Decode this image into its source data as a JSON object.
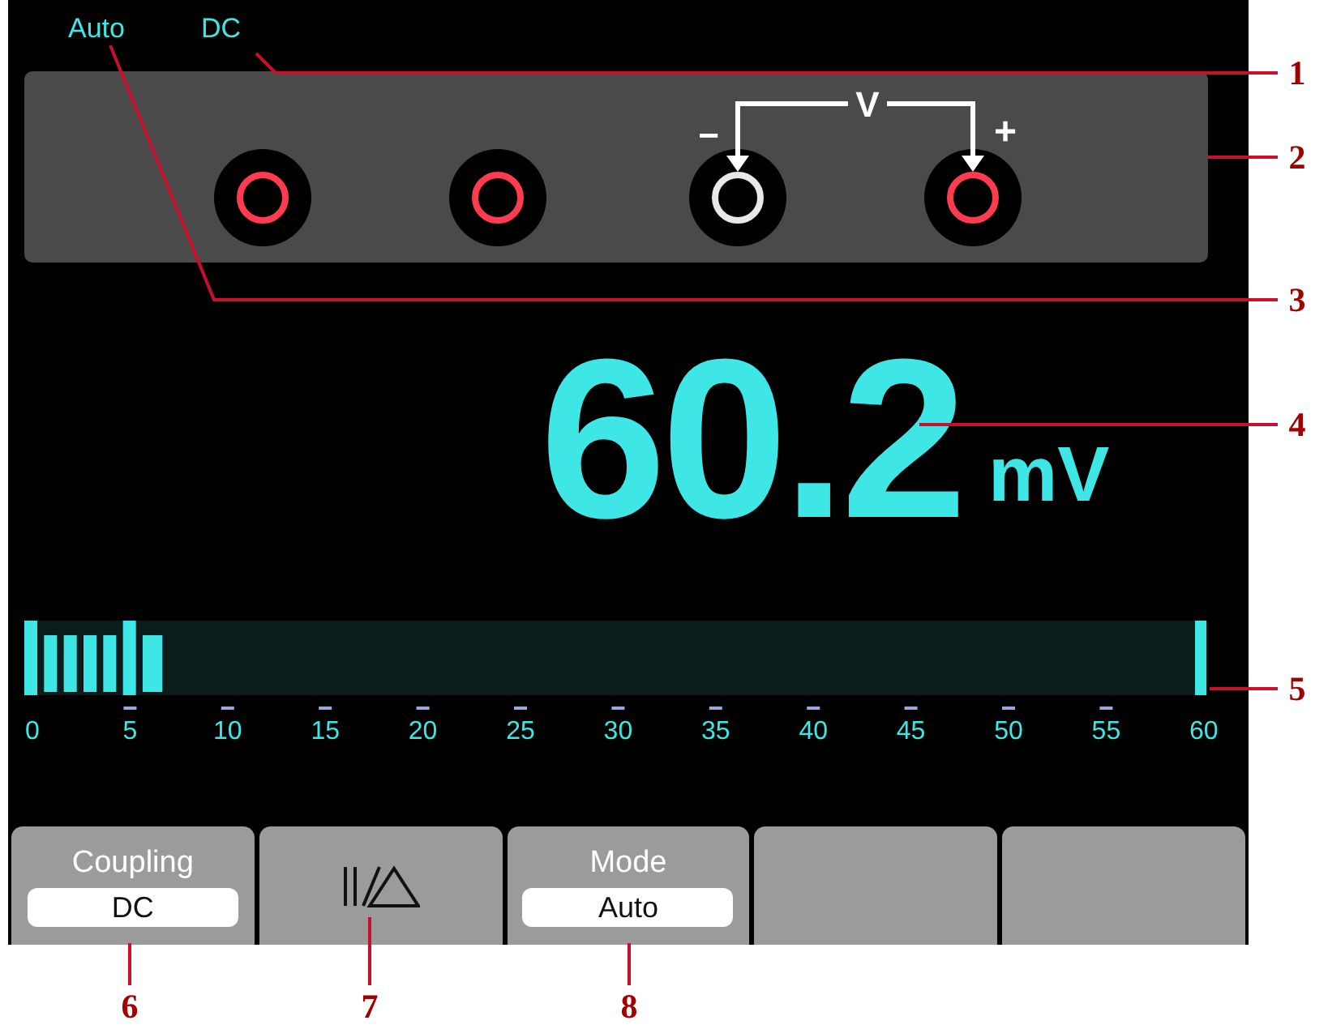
{
  "status": [
    {
      "text": "Auto"
    },
    {
      "text": "DC"
    }
  ],
  "jacks": [
    {
      "color": "#ff3b4e"
    },
    {
      "color": "#ff3b4e"
    },
    {
      "color": "#e8e8e8"
    },
    {
      "color": "#ff3b4e"
    }
  ],
  "probe_labels": {
    "negative": "−",
    "voltage": "V",
    "positive": "+"
  },
  "reading": {
    "value": "60.2",
    "unit": "mV"
  },
  "bar_graph": {
    "level": 0.117,
    "scale": [
      "0",
      "5",
      "10",
      "15",
      "20",
      "25",
      "30",
      "35",
      "40",
      "45",
      "50",
      "55",
      "60"
    ]
  },
  "softkeys": [
    {
      "kind": "labeled",
      "title": "Coupling",
      "value": "DC"
    },
    {
      "kind": "icon"
    },
    {
      "kind": "labeled",
      "title": "Mode",
      "value": "Auto"
    },
    {
      "kind": "blank"
    },
    {
      "kind": "blank"
    }
  ],
  "callouts": [
    {
      "label": "1"
    },
    {
      "label": "2"
    },
    {
      "label": "3"
    },
    {
      "label": "4"
    },
    {
      "label": "5"
    },
    {
      "label": "6"
    },
    {
      "label": "7"
    },
    {
      "label": "8"
    }
  ]
}
